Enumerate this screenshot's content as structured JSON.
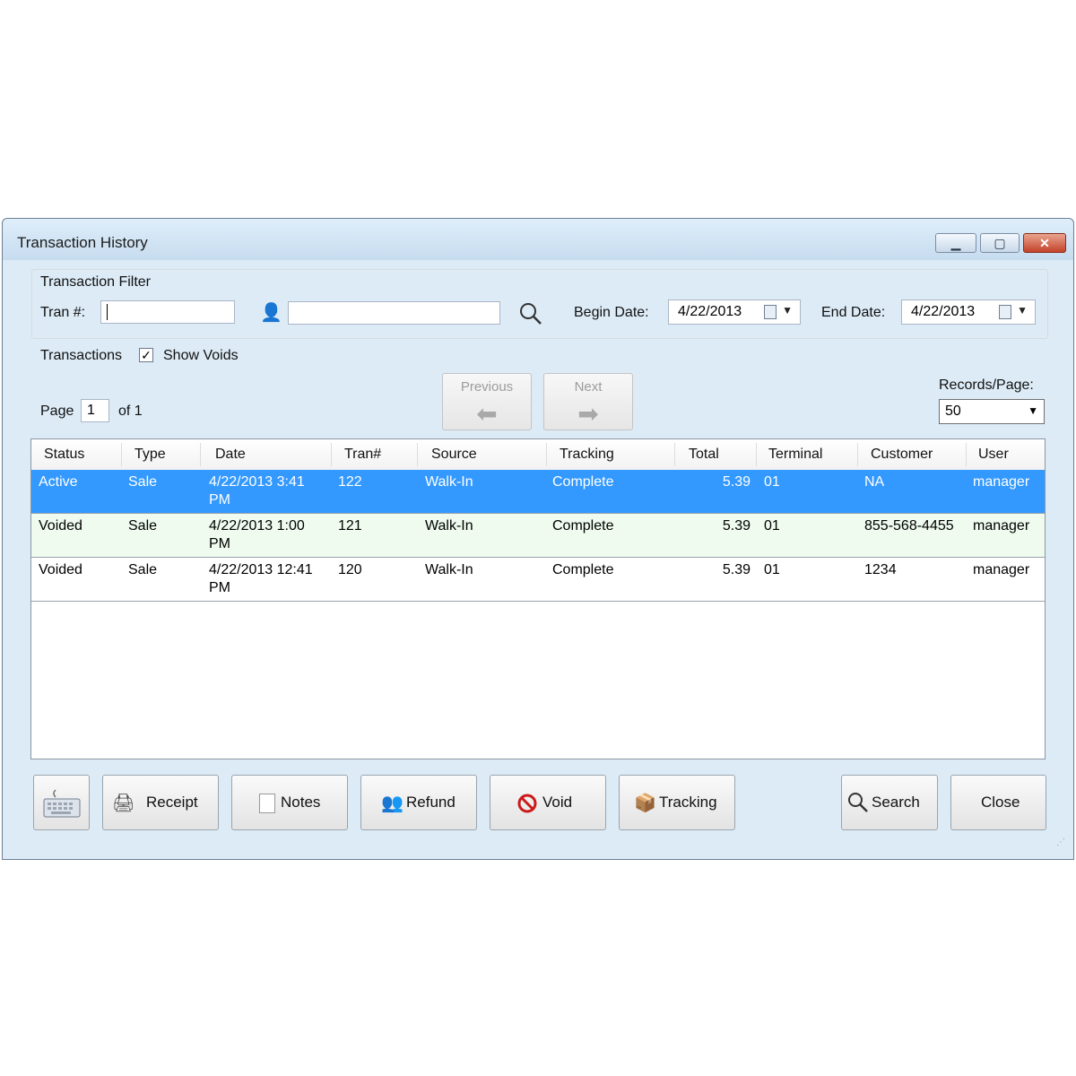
{
  "window": {
    "title": "Transaction History"
  },
  "filter": {
    "group_title": "Transaction Filter",
    "tran_label": "Tran #:",
    "tran_value": "",
    "customer_value": "",
    "begin_label": "Begin Date:",
    "begin_date": "4/22/2013",
    "end_label": "End Date:",
    "end_date": "4/22/2013"
  },
  "transactions": {
    "label": "Transactions",
    "show_voids_label": "Show Voids",
    "show_voids_checked": true
  },
  "paging": {
    "page_label": "Page",
    "page_value": "1",
    "of_label": "of 1",
    "previous_label": "Previous",
    "next_label": "Next",
    "records_label": "Records/Page:",
    "records_value": "50"
  },
  "table": {
    "columns": [
      "Status",
      "Type",
      "Date",
      "Tran#",
      "Source",
      "Tracking",
      "Total",
      "Terminal",
      "Customer",
      "User"
    ],
    "rows": [
      {
        "status": "Active",
        "type": "Sale",
        "date": "4/22/2013 3:41 PM",
        "tran": "122",
        "source": "Walk-In",
        "tracking": "Complete",
        "total": "5.39",
        "terminal": "01",
        "customer": "NA",
        "user": "manager"
      },
      {
        "status": "Voided",
        "type": "Sale",
        "date": "4/22/2013 1:00 PM",
        "tran": "121",
        "source": "Walk-In",
        "tracking": "Complete",
        "total": "5.39",
        "terminal": "01",
        "customer": "855-568-4455",
        "user": "manager"
      },
      {
        "status": "Voided",
        "type": "Sale",
        "date": "4/22/2013 12:41 PM",
        "tran": "120",
        "source": "Walk-In",
        "tracking": "Complete",
        "total": "5.39",
        "terminal": "01",
        "customer": "1234",
        "user": "manager"
      }
    ]
  },
  "buttons": {
    "receipt": "Receipt",
    "notes": "Notes",
    "refund": "Refund",
    "void": "Void",
    "tracking": "Tracking",
    "search": "Search",
    "close": "Close"
  },
  "colors": {
    "selected_row": "#3399ff",
    "alt_row": "#eefbee",
    "window_frame": "#dcebf6"
  }
}
